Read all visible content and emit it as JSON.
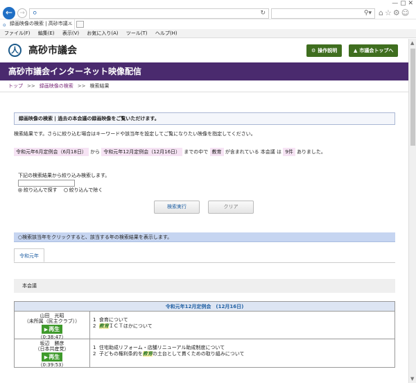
{
  "browser": {
    "tab_title": "録画映像の検索 | 高砂市議…",
    "menu": [
      "ファイル(F)",
      "編集(E)",
      "表示(V)",
      "お気に入り(A)",
      "ツール(T)",
      "ヘルプ(H)"
    ]
  },
  "site": {
    "name": "高砂市議会",
    "btn_help": "操作説明",
    "btn_top": "市議会トップへ",
    "banner": "高砂市議会インターネット映像配信"
  },
  "breadcrumb": {
    "home": "トップ",
    "search": "録画映像の検索",
    "current": "検索結果",
    "sep": ">>"
  },
  "info": {
    "heading": "録画映像の検索 | 過去の本会議の録画映像をご覧いただけます。",
    "desc": "検索結果です。さらに絞り込む場合はキーワードや該当年を設定してご覧になりたい映像を指定してください。"
  },
  "criteria": {
    "from": "令和元年6月定例会（6月18日）",
    "from_suffix": "から",
    "to": "令和元年12月定例会（12月16日）",
    "to_suffix": "までの中で",
    "keyword": "教育",
    "kw_suffix": "が含まれている",
    "meeting_prefix": "本会議",
    "meeting_mid": "は",
    "count": "9件",
    "count_suffix": "ありました。"
  },
  "refine": {
    "label": "下記の検索結果から絞り込み検索します。",
    "input_value": "",
    "opt_include": "絞り込んで探す",
    "opt_exclude": "絞り込んで除く"
  },
  "buttons": {
    "search": "検索実行",
    "clear": "クリア"
  },
  "year": {
    "bar": "○検索該当年をクリックすると、該当する年の検索結果を表示します。",
    "tab": "令和元年"
  },
  "council": {
    "label": "本会議"
  },
  "results": {
    "session": "令和元年12月定例会　(12月16日)",
    "play_label": "再生",
    "rows": [
      {
        "name": "山田　光昭",
        "party": "（未所属（民主クラブ））",
        "duration": "（0:38:47）",
        "topics": [
          {
            "num": "1",
            "pre": "食育について",
            "kw": "",
            "post": ""
          },
          {
            "num": "2",
            "pre": "",
            "kw": "教育",
            "post": "ＩＣＴほかについて"
          }
        ]
      },
      {
        "name": "坂辺　勝彦",
        "party": "（日本共産党）",
        "duration": "（0:39:53）",
        "topics": [
          {
            "num": "1",
            "pre": "住宅助成リフォーム・店舗リニューアル助成制度について",
            "kw": "",
            "post": ""
          },
          {
            "num": "2",
            "pre": "子どもの権利条約を",
            "kw": "教育",
            "post": "の土台として貫くための取り組みについて"
          }
        ]
      }
    ]
  }
}
